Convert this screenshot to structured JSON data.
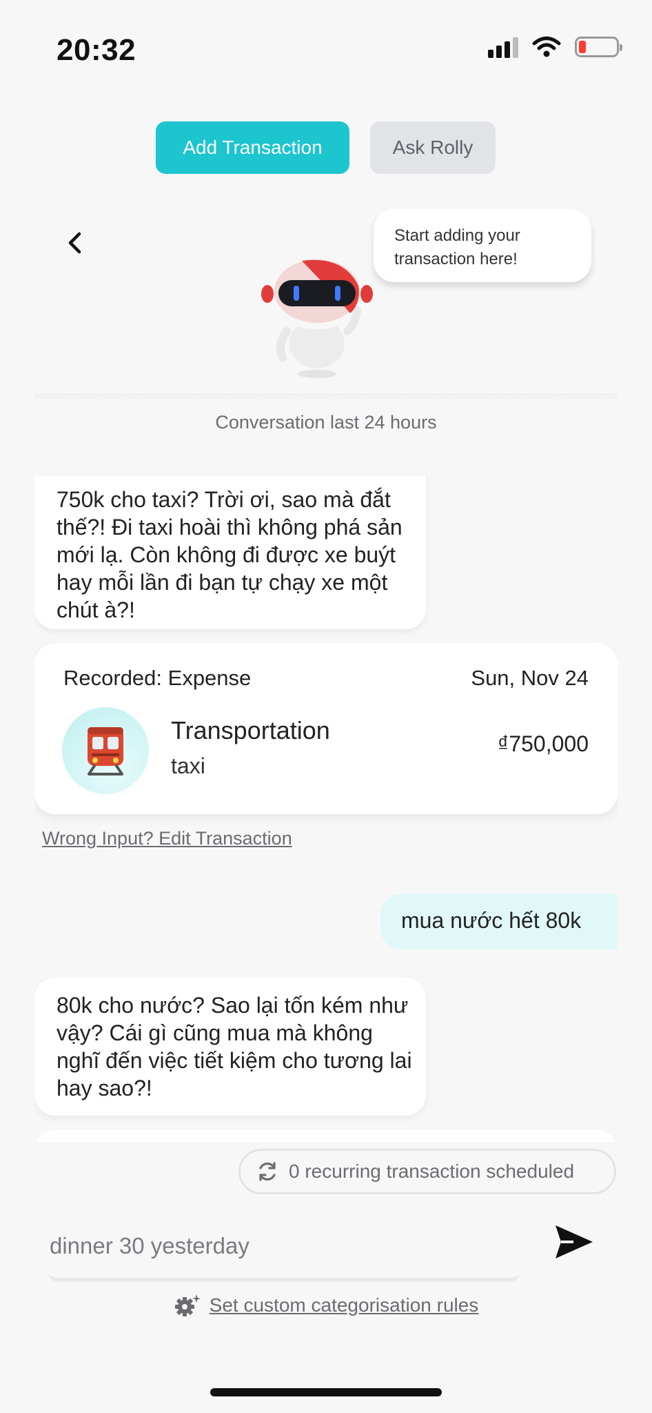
{
  "status_bar": {
    "time": "20:32"
  },
  "tabs": {
    "add": "Add Transaction",
    "ask": "Ask Rolly"
  },
  "assistant": {
    "bubble": "Start adding your transaction here!"
  },
  "conversation_label": "Conversation last 24 hours",
  "messages": {
    "bot1": "750k cho taxi? Trời ơi, sao mà đắt thế?! Đi taxi hoài thì không phá sản mới lạ. Còn không đi được xe buýt hay mỗi lần đi bạn tự chạy xe một chút à?!",
    "transaction": {
      "recorded": "Recorded: Expense",
      "date": "Sun, Nov 24",
      "category": "Transportation",
      "note": "taxi",
      "amount": "₫750,000",
      "icon": "train-icon"
    },
    "edit_link": "Wrong Input? Edit Transaction",
    "user1": "mua nước hết 80k",
    "bot2": "80k cho nước? Sao lại tốn kém như vậy? Cái gì cũng mua mà không nghĩ đến việc tiết kiệm cho tương lai hay sao?!"
  },
  "recurring": "0 recurring transaction scheduled",
  "composer": {
    "placeholder": "dinner 30 yesterday"
  },
  "rules_link": "Set custom categorisation rules",
  "colors": {
    "accent": "#1dc5cf",
    "user_bubble": "#e0f8f8",
    "battery_low": "#ff3b30"
  }
}
